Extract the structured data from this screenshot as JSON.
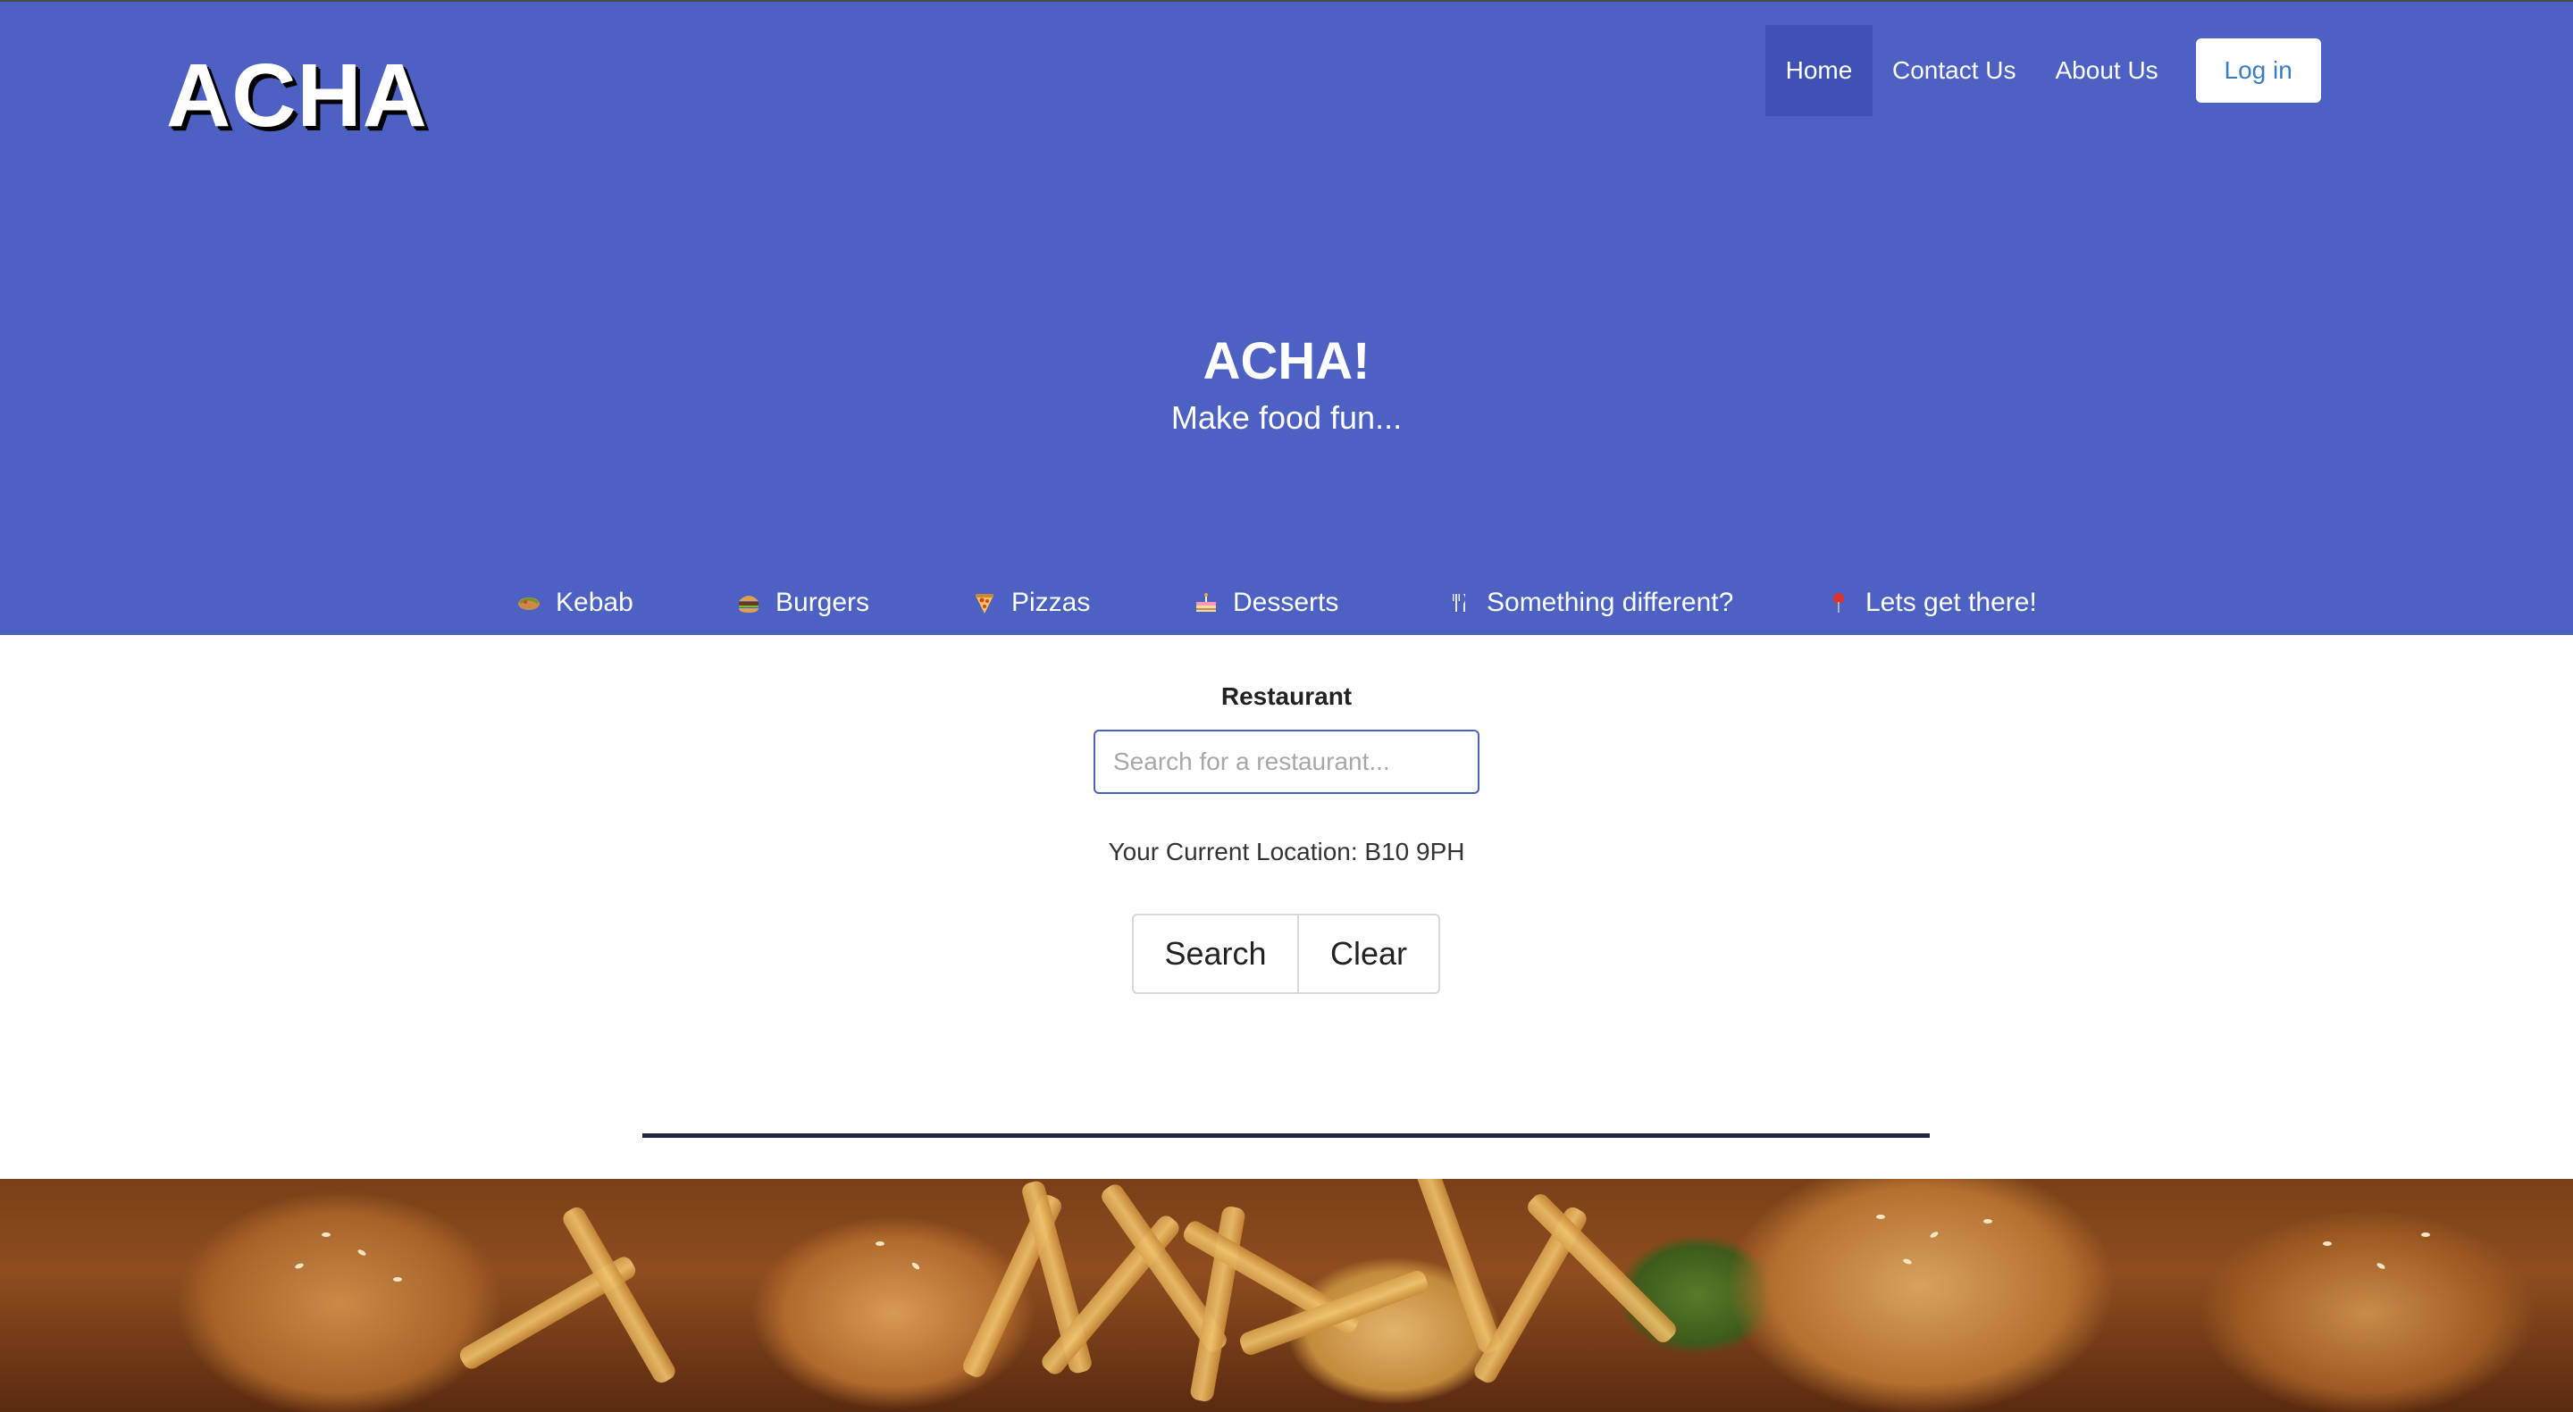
{
  "header": {
    "logo": "ACHA",
    "nav": [
      {
        "label": "Home",
        "active": true
      },
      {
        "label": "Contact Us",
        "active": false
      },
      {
        "label": "About Us",
        "active": false
      }
    ],
    "login_label": "Log in"
  },
  "hero": {
    "title": "ACHA!",
    "subtitle": "Make food fun..."
  },
  "categories": [
    {
      "icon": "kebab-icon",
      "label": "Kebab"
    },
    {
      "icon": "burger-icon",
      "label": "Burgers"
    },
    {
      "icon": "pizza-icon",
      "label": "Pizzas"
    },
    {
      "icon": "cake-icon",
      "label": "Desserts"
    },
    {
      "icon": "fork-knife-icon",
      "label": "Something different?"
    },
    {
      "icon": "location-pin-icon",
      "label": "Lets get there!"
    }
  ],
  "search": {
    "label": "Restaurant",
    "placeholder": "Search for a restaurant...",
    "value": "",
    "location_text": "Your Current Location: B10 9PH",
    "search_label": "Search",
    "clear_label": "Clear"
  },
  "colors": {
    "hero_bg": "#4c61c1",
    "active_nav_bg": "#3d52b4",
    "login_text": "#3a7cc4",
    "divider": "#1f2547"
  },
  "footer_image": {
    "icon": "food-photo"
  }
}
